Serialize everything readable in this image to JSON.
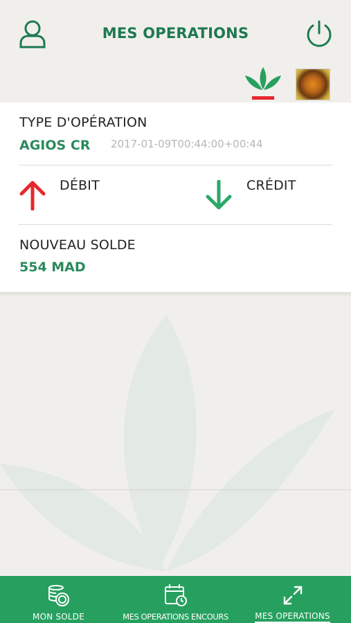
{
  "header": {
    "title": "MES OPERATIONS",
    "left_icon": "user-icon",
    "right_icon": "power-icon"
  },
  "operation": {
    "type_label": "TYPE D'OPÉRATION",
    "type_value": "AGIOS CR",
    "datetime": "2017-01-09T00:44:00+00:44",
    "debit_label": "DÉBIT",
    "credit_label": "CRÉDIT",
    "balance_label": "NOUVEAU SOLDE",
    "balance_value": "554 MAD"
  },
  "colors": {
    "accent": "#27a05f",
    "title_green": "#1d7a4f",
    "debit_red": "#e8262d",
    "credit_green": "#2aa86a"
  },
  "tabbar": {
    "tabs": [
      {
        "label": "MON SOLDE",
        "icon": "coins-icon"
      },
      {
        "label": "MES OPERATIONS ENCOURS",
        "icon": "calendar-clock-icon"
      },
      {
        "label": "MES OPERATIONS",
        "icon": "transfer-arrows-icon",
        "active": true
      }
    ]
  }
}
